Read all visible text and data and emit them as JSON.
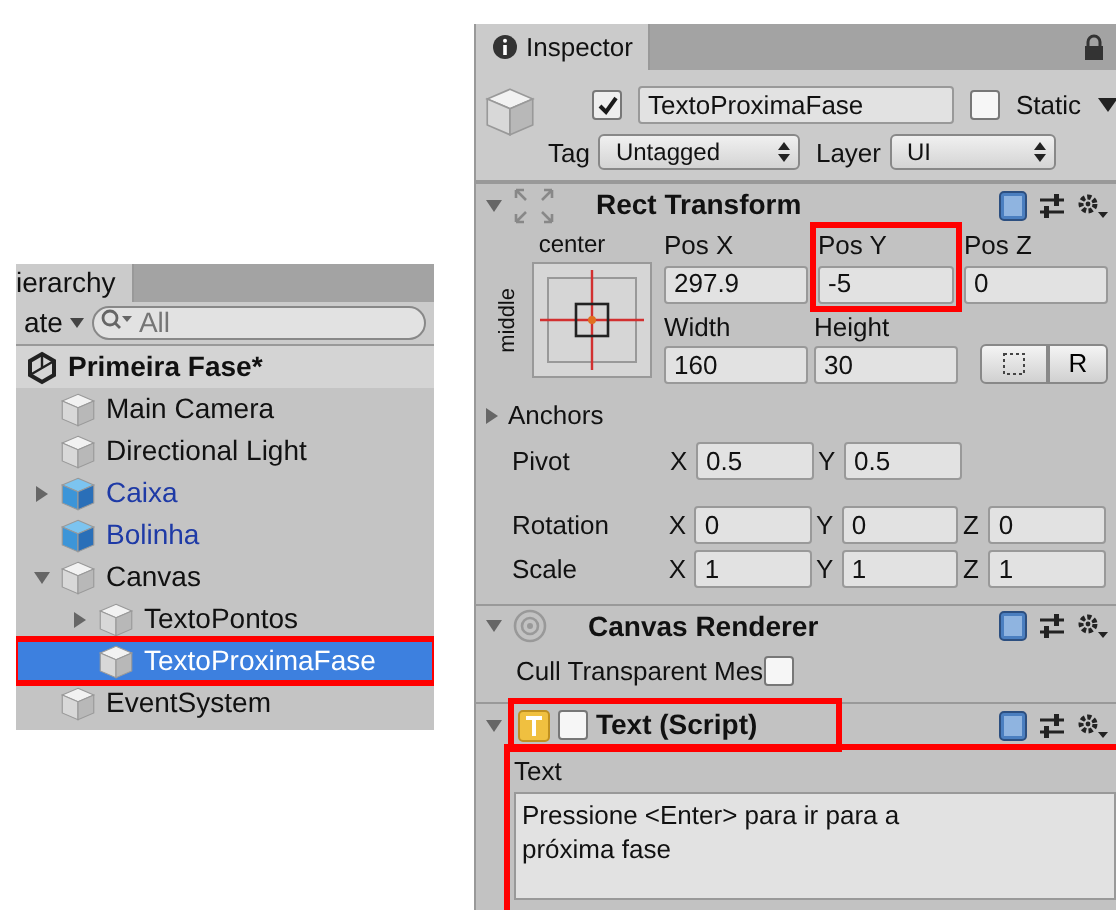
{
  "hierarchy": {
    "tab": "ierarchy",
    "create_label": "ate",
    "search": {
      "placeholder": "All"
    },
    "scene": {
      "title": "Primeira Fase*"
    },
    "items": [
      {
        "label": "Main Camera",
        "kind": "object",
        "selected": false,
        "highlighted": false
      },
      {
        "label": "Directional Light",
        "kind": "object",
        "selected": false,
        "highlighted": false
      },
      {
        "label": "Caixa",
        "kind": "prefab",
        "expanded": false,
        "selected": false,
        "highlighted": false
      },
      {
        "label": "Bolinha",
        "kind": "prefab",
        "selected": false,
        "highlighted": false
      },
      {
        "label": "Canvas",
        "kind": "object",
        "expanded": true,
        "selected": false,
        "highlighted": false,
        "children": [
          {
            "label": "TextoPontos",
            "kind": "object",
            "expanded": false,
            "selected": false,
            "highlighted": false
          },
          {
            "label": "TextoProximaFase",
            "kind": "object",
            "selected": true,
            "highlighted": true
          }
        ]
      },
      {
        "label": "EventSystem",
        "kind": "object",
        "selected": false,
        "highlighted": false
      }
    ]
  },
  "inspector": {
    "tab": "Inspector",
    "active": true,
    "name": "TextoProximaFase",
    "static_label": "Static",
    "static": false,
    "tag_label": "Tag",
    "tag": "Untagged",
    "layer_label": "Layer",
    "layer": "UI",
    "components": [
      {
        "kind": "rect_transform",
        "title": "Rect Transform",
        "expanded": true,
        "anchor_h": "center",
        "anchor_v": "middle",
        "fields": [
          {
            "label": "Pos X",
            "value": "297.9",
            "highlighted": false
          },
          {
            "label": "Pos Y",
            "value": "-5",
            "highlighted": true
          },
          {
            "label": "Pos Z",
            "value": "0",
            "highlighted": false
          },
          {
            "label": "Width",
            "value": "160",
            "highlighted": false
          },
          {
            "label": "Height",
            "value": "30",
            "highlighted": false
          }
        ],
        "reset_button": "R",
        "anchors_label": "Anchors",
        "anchors_expanded": false,
        "rows": [
          {
            "label": "Pivot",
            "fields": [
              {
                "axis": "X",
                "value": "0.5"
              },
              {
                "axis": "Y",
                "value": "0.5"
              }
            ]
          },
          {
            "label": "Rotation",
            "fields": [
              {
                "axis": "X",
                "value": "0"
              },
              {
                "axis": "Y",
                "value": "0"
              },
              {
                "axis": "Z",
                "value": "0"
              }
            ]
          },
          {
            "label": "Scale",
            "fields": [
              {
                "axis": "X",
                "value": "1"
              },
              {
                "axis": "Y",
                "value": "1"
              },
              {
                "axis": "Z",
                "value": "1"
              }
            ]
          }
        ]
      },
      {
        "kind": "canvas_renderer",
        "title": "Canvas Renderer",
        "expanded": true,
        "toggles": [
          {
            "label": "Cull Transparent Mes",
            "checked": false
          }
        ]
      },
      {
        "kind": "text_script",
        "title": "Text (Script)",
        "expanded": true,
        "enabled": false,
        "highlighted": true,
        "text_label": "Text",
        "text": "Pressione <Enter> para ir para a\npróxima fase",
        "text_highlighted": true
      }
    ]
  }
}
